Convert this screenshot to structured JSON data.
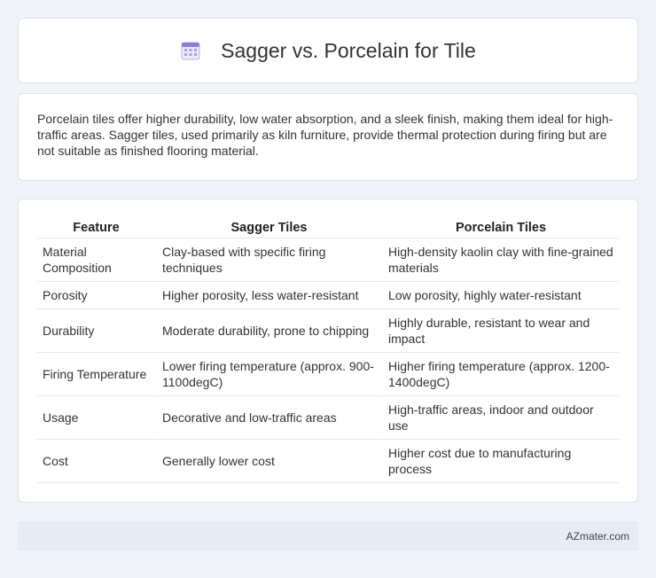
{
  "header": {
    "title": "Sagger vs. Porcelain for Tile",
    "icon": "calendar-icon"
  },
  "intro": {
    "text": "Porcelain tiles offer higher durability, low water absorption, and a sleek finish, making them ideal for high-traffic areas. Sagger tiles, used primarily as kiln furniture, provide thermal protection during firing but are not suitable as finished flooring material."
  },
  "table": {
    "headers": [
      "Feature",
      "Sagger Tiles",
      "Porcelain Tiles"
    ],
    "rows": [
      [
        "Material Composition",
        "Clay-based with specific firing techniques",
        "High-density kaolin clay with fine-grained materials"
      ],
      [
        "Porosity",
        "Higher porosity, less water-resistant",
        "Low porosity, highly water-resistant"
      ],
      [
        "Durability",
        "Moderate durability, prone to chipping",
        "Highly durable, resistant to wear and impact"
      ],
      [
        "Firing Temperature",
        "Lower firing temperature (approx. 900-1100degC)",
        "Higher firing temperature (approx. 1200-1400degC)"
      ],
      [
        "Usage",
        "Decorative and low-traffic areas",
        "High-traffic areas, indoor and outdoor use"
      ],
      [
        "Cost",
        "Generally lower cost",
        "Higher cost due to manufacturing process"
      ]
    ]
  },
  "footer": {
    "brand": "AZmater.com"
  },
  "colors": {
    "background": "#f0f3f8",
    "card": "#ffffff",
    "footer": "#e6ecf5",
    "icon_accent": "#8b7fd9"
  }
}
